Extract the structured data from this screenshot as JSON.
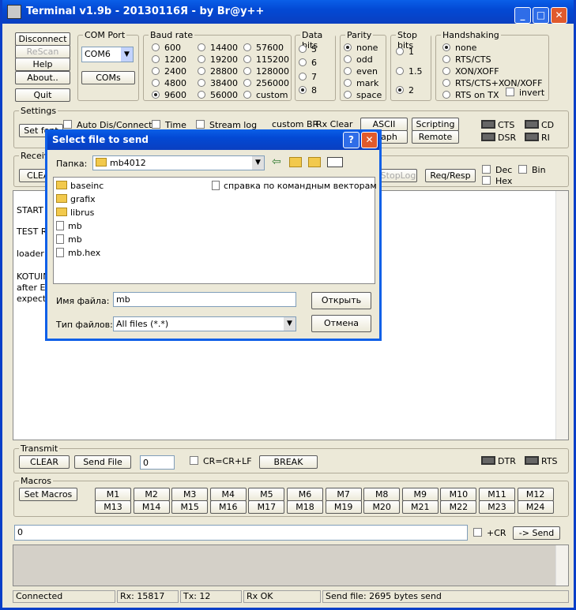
{
  "window": {
    "title": "Terminal v1.9b - 20130116Я - by Br@y++"
  },
  "conn_buttons": {
    "disconnect": "Disconnect",
    "rescan": "ReScan",
    "help": "Help",
    "about": "About..",
    "quit": "Quit"
  },
  "com_port": {
    "label": "COM Port",
    "value": "COM6",
    "coms_button": "COMs"
  },
  "baud": {
    "label": "Baud rate",
    "options": [
      "600",
      "1200",
      "2400",
      "4800",
      "9600",
      "14400",
      "19200",
      "28800",
      "38400",
      "56000",
      "57600",
      "115200",
      "128000",
      "256000",
      "custom"
    ],
    "selected": "9600"
  },
  "databits": {
    "label": "Data bits",
    "options": [
      "5",
      "6",
      "7",
      "8"
    ],
    "selected": "8"
  },
  "parity": {
    "label": "Parity",
    "options": [
      "none",
      "odd",
      "even",
      "mark",
      "space"
    ],
    "selected": "none"
  },
  "stopbits": {
    "label": "Stop bits",
    "options": [
      "1",
      "1.5",
      "2"
    ],
    "selected": "2"
  },
  "handshaking": {
    "label": "Handshaking",
    "options": [
      "none",
      "RTS/CTS",
      "XON/XOFF",
      "RTS/CTS+XON/XOFF",
      "RTS on TX"
    ],
    "selected": "none",
    "invert": "invert"
  },
  "settings": {
    "label": "Settings",
    "set_font": "Set font",
    "auto_dis": "Auto Dis/Connect",
    "time": "Time",
    "stream_log": "Stream log",
    "custom_br": "custom BR",
    "rx_clear": "Rx Clear",
    "ascii_table": "ASCII table",
    "scripting": "Scripting",
    "graph": "Graph",
    "remote": "Remote"
  },
  "leds": {
    "cts": "CTS",
    "cd": "CD",
    "dsr": "DSR",
    "ri": "RI",
    "dtr": "DTR",
    "rts": "RTS"
  },
  "receive": {
    "label": "Receive",
    "clear": "CLEAR",
    "stoplog": "StopLog",
    "reqresp": "Req/Resp",
    "dec": "Dec",
    "bin": "Bin",
    "hex": "Hex"
  },
  "terminal_lines": [
    "START",
    "TEST RA",
    "loader in",
    "KOTUINO",
    "after EL",
    "expect"
  ],
  "transmit": {
    "label": "Transmit",
    "clear": "CLEAR",
    "send_file": "Send File",
    "counter": "0",
    "crlf": "CR=CR+LF",
    "break": "BREAK"
  },
  "macros": {
    "label": "Macros",
    "set_macros": "Set Macros",
    "row1": [
      "M1",
      "M2",
      "M3",
      "M4",
      "M5",
      "M6",
      "M7",
      "M8",
      "M9",
      "M10",
      "M11",
      "M12"
    ],
    "row2": [
      "M13",
      "M14",
      "M15",
      "M16",
      "M17",
      "M18",
      "M19",
      "M20",
      "M21",
      "M22",
      "M23",
      "M24"
    ]
  },
  "send_line": {
    "value": "0",
    "plus_cr": "+CR",
    "send": "-> Send"
  },
  "status": {
    "connected": "Connected",
    "rx": "Rx: 15817",
    "tx": "Tx: 12",
    "rx_ok": "Rx OK",
    "sent": "Send file: 2695 bytes send"
  },
  "dialog": {
    "title": "Select file to send",
    "folder_label": "Папка:",
    "folder": "mb4012",
    "files_left": [
      {
        "name": "baseinc",
        "type": "folder"
      },
      {
        "name": "grafix",
        "type": "folder"
      },
      {
        "name": "librus",
        "type": "folder"
      },
      {
        "name": "mb",
        "type": "file"
      },
      {
        "name": "mb",
        "type": "file"
      },
      {
        "name": "mb.hex",
        "type": "file"
      }
    ],
    "file_right": "справка по командным векторам",
    "filename_label": "Имя файла:",
    "filename": "mb",
    "filetype_label": "Тип файлов:",
    "filetype": "All files (*.*)",
    "open": "Открыть",
    "cancel": "Отмена"
  }
}
